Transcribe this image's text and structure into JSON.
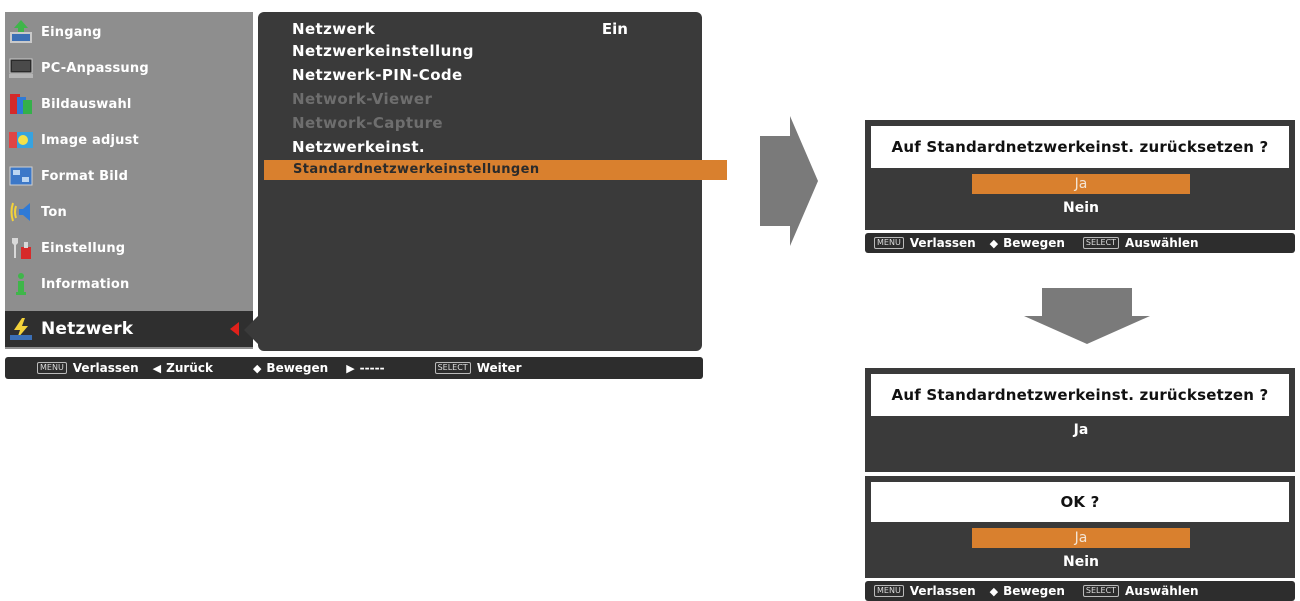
{
  "main_menu": {
    "items": [
      {
        "label": "Eingang",
        "icon": "input-icon"
      },
      {
        "label": "PC-Anpassung",
        "icon": "pc-adjust-icon"
      },
      {
        "label": "Bildauswahl",
        "icon": "image-select-icon"
      },
      {
        "label": "Image adjust",
        "icon": "image-adjust-icon"
      },
      {
        "label": "Format Bild",
        "icon": "screen-format-icon"
      },
      {
        "label": "Ton",
        "icon": "sound-icon"
      },
      {
        "label": "Einstellung",
        "icon": "setting-icon"
      },
      {
        "label": "Information",
        "icon": "information-icon"
      },
      {
        "label": "Netzwerk",
        "icon": "network-icon"
      }
    ],
    "active_index": 8
  },
  "submenu": {
    "value": "Ein",
    "items": [
      {
        "label": "Netzwerk",
        "state": "normal"
      },
      {
        "label": "Netzwerkeinstellung",
        "state": "normal"
      },
      {
        "label": "Netzwerk-PIN-Code",
        "state": "normal"
      },
      {
        "label": "Network-Viewer",
        "state": "disabled"
      },
      {
        "label": "Network-Capture",
        "state": "disabled"
      },
      {
        "label": "Netzwerkeinst.",
        "state": "normal"
      },
      {
        "label": "Standardnetzwerkeinstellungen",
        "state": "selected"
      }
    ]
  },
  "main_statusbar": {
    "menu_key": "MENU",
    "exit": "Verlassen",
    "back_sym": "◀",
    "back": "Zurück",
    "move_sym": "◆",
    "move": "Bewegen",
    "next_sym": "▶",
    "next": "-----",
    "select_key": "SELECT",
    "continue": "Weiter"
  },
  "dialog1": {
    "question": "Auf Standardnetzwerkeinst. zurücksetzen ?",
    "options": [
      "Ja",
      "Nein"
    ],
    "statusbar": {
      "menu_key": "MENU",
      "exit": "Verlassen",
      "move_sym": "◆",
      "move": "Bewegen",
      "select_key": "SELECT",
      "select": "Auswählen"
    }
  },
  "dialog2": {
    "question": "Auf Standardnetzwerkeinst. zurücksetzen ?",
    "answer": "Ja",
    "confirm_question": "OK ?",
    "options": [
      "Ja",
      "Nein"
    ],
    "statusbar": {
      "menu_key": "MENU",
      "exit": "Verlassen",
      "move_sym": "◆",
      "move": "Bewegen",
      "select_key": "SELECT",
      "select": "Auswählen"
    }
  },
  "colors": {
    "accent": "#d9802e",
    "panel_dark": "#3a3a3a",
    "panel_grey": "#8e8e8e",
    "arrow_grey": "#7a7a7a"
  }
}
